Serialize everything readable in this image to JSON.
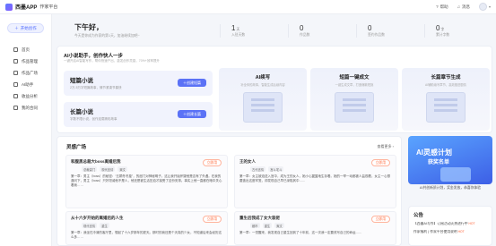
{
  "app": {
    "name": "西墨APP",
    "subtitle": "作家平台"
  },
  "topbar": {
    "help": "帮助",
    "messages": "消息"
  },
  "sidebar": {
    "new_button": "开始创作",
    "items": [
      {
        "label": "首页",
        "icon": "home-icon"
      },
      {
        "label": "作品管理",
        "icon": "book-icon"
      },
      {
        "label": "作品广场",
        "icon": "square-icon"
      },
      {
        "label": "AI助手",
        "icon": "ai-icon"
      },
      {
        "label": "收益分析",
        "icon": "chart-icon"
      },
      {
        "label": "我的合同",
        "icon": "contract-icon"
      }
    ]
  },
  "hero": {
    "greeting": "下午好，",
    "subtext": "今天是你成为作家的第1天，加油继续加吧~",
    "stats": [
      {
        "value": "1",
        "unit": "天",
        "label": "入驻天数"
      },
      {
        "value": "0",
        "unit": "",
        "label": "作品数"
      },
      {
        "value": "0",
        "unit": "",
        "label": "签约作品数"
      },
      {
        "value": "0",
        "unit": "字",
        "label": "累计字数"
      }
    ]
  },
  "ai_panel": {
    "title": "AI小说助手，创作快人一步",
    "subtitle": "一键开启AI智能写作，帮你快速产出，激发创作灵感，70%+效率提升",
    "genres": [
      {
        "title": "短篇小说",
        "desc": "2万-5万字短篇故事，情节紧凑节奏快",
        "button": "创建短篇"
      },
      {
        "title": "长篇小说",
        "desc": "字数不限小说，创作连载精彩故事",
        "button": "创建长篇"
      }
    ],
    "tools": [
      {
        "title": "AI续写",
        "desc": "补全你的故事，智能生成后续内容"
      },
      {
        "title": "短篇一键成文",
        "desc": "一键生成文章，打造爆款短篇"
      },
      {
        "title": "长篇章节生成",
        "desc": "AI辅助续写章节，高效推进剧情"
      }
    ]
  },
  "inspiration": {
    "title": "灵感广场",
    "more": "查看更多 ›",
    "use_label": "立即用",
    "cards": [
      {
        "title": "和腹黑总裁大boss离婚后我",
        "tags": [
          "总裁豪门",
          "现代言情",
          "爽文"
        ],
        "body": "第一章：男主（boss）的秘密：“五颗冬冬旋”，的闺门对神秘明子。这让我开始怀疑他是否有了外遇。在我的逼问下，男主（boss）只好坦诚他不是人，他还是被生活压迫才接受了这份安排。事实上他一直都在暗中关心着我……"
      },
      {
        "title": "王的女人",
        "tags": [
          "古代言情",
          "宫斗宅斗"
        ],
        "body": "第一章：女主被迫送入宫中，成为王的女人，她小心翼翼地生存着。她的一举一动都被人监视着，女主一心想要逃出这座牢笼，却发现自己早已深陷其中……"
      },
      {
        "title": "从十六岁开始的离婚后的人生",
        "tags": [
          "现代言情",
          "重生"
        ],
        "body": "第一章：我坐在冷清的客厅里，想起了十六岁那年的夏天。那时的我还是个天真的少女，不知道后来会经历这么多……"
      },
      {
        "title": "重生后我成了女大装佬",
        "tags": [
          "都市",
          "重生",
          "爽文"
        ],
        "body": "第一章：一觉醒来，我发现自己重生回到了十年前，这一次我一定要改写自己的命运……"
      }
    ]
  },
  "banner": {
    "line1": "AI灵感计划",
    "line2": "获奖名单",
    "caption": "AI共创新质计划，奖金发放，恭喜你体验"
  },
  "notice": {
    "title": "公告",
    "items": [
      {
        "text": "【西墨AI写作】订阅活动火热进行中",
        "hot": "HOT"
      },
      {
        "text": "作家福利 | 作家平台使用说明",
        "hot": "HOT"
      }
    ]
  }
}
